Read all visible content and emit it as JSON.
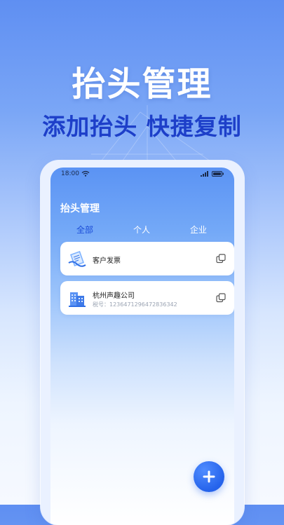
{
  "hero": {
    "title": "抬头管理",
    "subtitle": "添加抬头 快捷复制"
  },
  "status_bar": {
    "time": "18:00"
  },
  "app": {
    "title": "抬头管理",
    "tabs": [
      {
        "label": "全部",
        "active": true
      },
      {
        "label": "个人",
        "active": false
      },
      {
        "label": "企业",
        "active": false
      }
    ],
    "items": [
      {
        "name": "客户发票",
        "icon": "invoice-icon"
      },
      {
        "name": "杭州声趣公司",
        "tax_label": "税号：",
        "tax_number": "1236471296472836342",
        "icon": "building-icon"
      }
    ]
  },
  "colors": {
    "accent": "#2563eb",
    "subtitle": "#1d3fc9",
    "tab_active": "#1d4ed8"
  }
}
